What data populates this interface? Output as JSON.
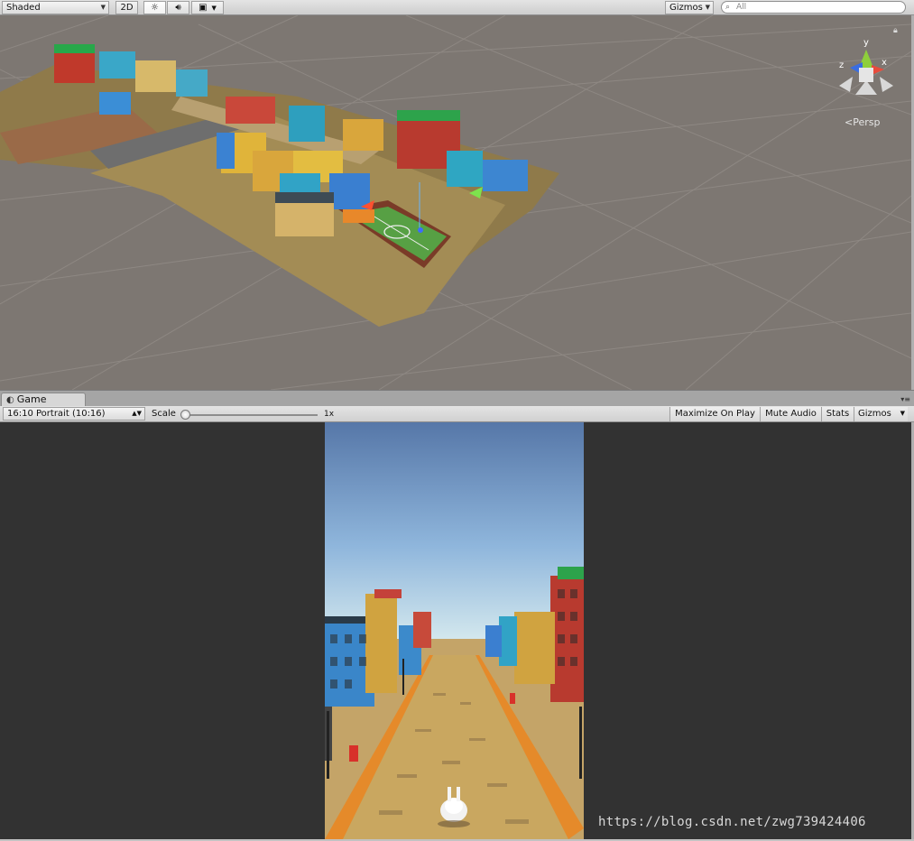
{
  "scene_toolbar": {
    "shading_mode": "Shaded",
    "mode_2d": "2D",
    "gizmos_label": "Gizmos",
    "search_placeholder": "All"
  },
  "scene_view": {
    "projection_label": "Persp",
    "gizmo_axes": {
      "x": "x",
      "y": "y",
      "z": "z"
    }
  },
  "game_tab": {
    "label": "Game"
  },
  "game_toolbar": {
    "resolution": "16:10 Portrait (10:16)",
    "scale_label": "Scale",
    "scale_value": "1x",
    "maximize_on_play": "Maximize On Play",
    "mute_audio": "Mute Audio",
    "stats": "Stats",
    "gizmos": "Gizmos"
  },
  "watermark": "https://blog.csdn.net/zwg739424406",
  "colors": {
    "scene_background": "#7d7772",
    "game_background": "#323232",
    "sky_top": "#5677a8",
    "sky_bottom": "#d9ecef",
    "road": "#c9a760",
    "curb": "#e58a2a"
  }
}
